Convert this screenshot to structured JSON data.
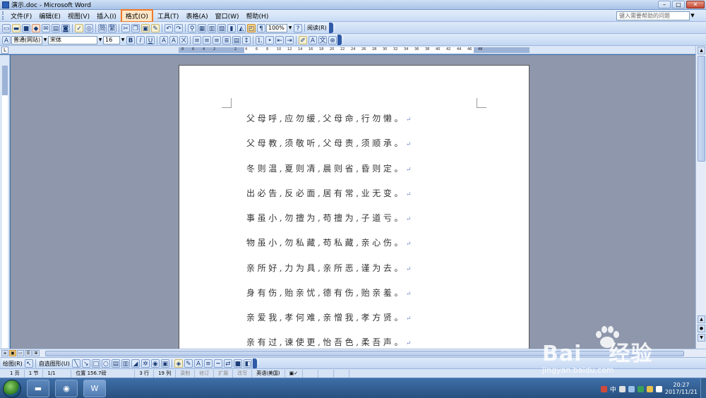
{
  "window": {
    "title": "演示.doc - Microsoft Word",
    "minimize": "–",
    "maximize": "□",
    "close": "✕"
  },
  "menubar": {
    "items": [
      "文件(F)",
      "编辑(E)",
      "视图(V)",
      "插入(I)",
      "格式(O)",
      "工具(T)",
      "表格(A)",
      "窗口(W)",
      "帮助(H)"
    ],
    "active_index": 4,
    "help_placeholder": "键入需要帮助的问题",
    "mdi_buttons": [
      "_",
      "□",
      "×"
    ]
  },
  "standard_toolbar": {
    "zoom": "100%",
    "read_button": "阅读(R)"
  },
  "formatting_toolbar": {
    "style": "普通(网站)",
    "font": "宋体",
    "size": "16"
  },
  "ruler": {
    "ticks": [
      "8",
      "6",
      "4",
      "2",
      "",
      "2",
      "4",
      "6",
      "8",
      "10",
      "12",
      "14",
      "16",
      "18",
      "20",
      "22",
      "24",
      "26",
      "28",
      "30",
      "32",
      "34",
      "36",
      "38",
      "40",
      "42",
      "44",
      "46",
      "48"
    ]
  },
  "document": {
    "lines": [
      "父母呼,应勿缓,父母命,行勿懒。",
      "父母教,须敬听,父母责,须顺承。",
      "冬则温,夏则凊,晨则省,昏则定。",
      "出必告,反必面,居有常,业无变。",
      "事虽小,勿擅为,苟擅为,子道亏。",
      "物虽小,勿私藏,苟私藏,亲心伤。",
      "亲所好,力为具,亲所恶,谨为去。",
      "身有伤,贻亲忧,德有伤,贻亲羞。",
      "亲爱我,孝何难,亲憎我,孝方贤。",
      "亲有过,谏使更,怡吾色,柔吾声。"
    ],
    "paragraph_mark": "↵"
  },
  "drawing_toolbar": {
    "draw_label": "绘图(R)",
    "autoshapes_label": "自选图形(U)"
  },
  "status_bar": {
    "page": "1 页",
    "section": "1 节",
    "page_of": "1/1",
    "position": "位置 156.7磅",
    "line": "3 行",
    "column": "19 列",
    "rec": "录制",
    "trk": "修订",
    "ext": "扩展",
    "ovr": "改写",
    "language": "英语(美国)"
  },
  "taskbar": {
    "lang_indicator": "中",
    "time": "20:27",
    "date": "2017/11/21"
  },
  "watermark": {
    "logo_left": "Bai",
    "logo_right": "经验",
    "url": "jingyan.baidu.com"
  },
  "colors": {
    "menu_highlight_border": "#f07a2a",
    "doc_background": "#8e97ab",
    "taskbar": "#27507f"
  }
}
